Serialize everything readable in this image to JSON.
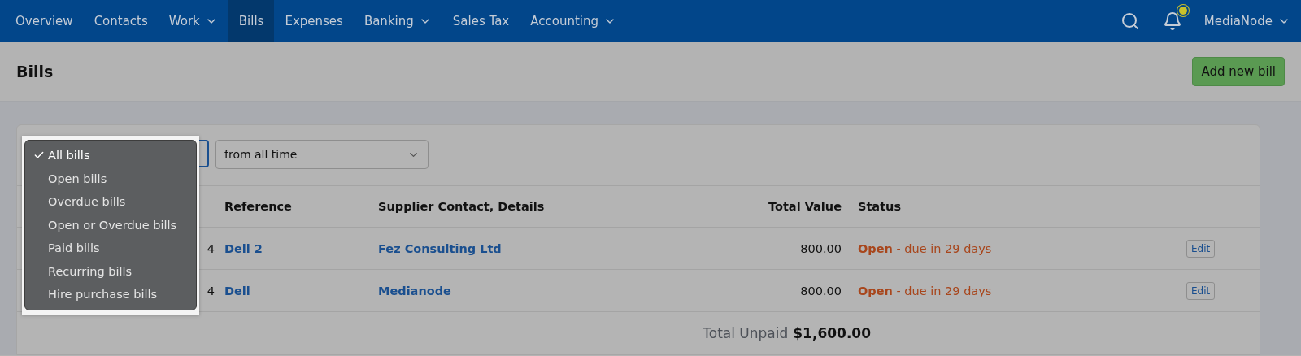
{
  "nav": {
    "items": [
      {
        "label": "Overview",
        "selected": false,
        "has_menu": false
      },
      {
        "label": "Contacts",
        "selected": false,
        "has_menu": false
      },
      {
        "label": "Work",
        "selected": false,
        "has_menu": true
      },
      {
        "label": "Bills",
        "selected": true,
        "has_menu": false
      },
      {
        "label": "Expenses",
        "selected": false,
        "has_menu": false
      },
      {
        "label": "Banking",
        "selected": false,
        "has_menu": true
      },
      {
        "label": "Sales Tax",
        "selected": false,
        "has_menu": false
      },
      {
        "label": "Accounting",
        "selected": false,
        "has_menu": true
      }
    ],
    "notifications_unread": true,
    "account": "MediaNode"
  },
  "header": {
    "title": "Bills",
    "button": "Add new bill"
  },
  "filters": {
    "bill_type_menu": [
      {
        "label": "All bills",
        "selected": true
      },
      {
        "label": "Open bills",
        "selected": false
      },
      {
        "label": "Overdue bills",
        "selected": false
      },
      {
        "label": "Open or Overdue bills",
        "selected": false
      },
      {
        "label": "Paid bills",
        "selected": false
      },
      {
        "label": "Recurring bills",
        "selected": false
      },
      {
        "label": "Hire purchase bills",
        "selected": false
      }
    ],
    "period": "from all time"
  },
  "table": {
    "columns": [
      "Reference",
      "Supplier Contact, Details",
      "Total Value",
      "Status"
    ],
    "rows": [
      {
        "column_1": "4",
        "reference": "Dell 2",
        "supplier": "Fez Consulting Ltd",
        "total": "800.00",
        "status": "**Open** - due in 29 days",
        "action": "Edit"
      },
      {
        "column_1": "4",
        "reference": "Dell",
        "supplier": "Medianode",
        "total": "800.00",
        "status": "**Open** - due in 29 days",
        "action": "Edit"
      }
    ],
    "total_label": "Total Unpaid",
    "total_value": "$1,600.00"
  }
}
